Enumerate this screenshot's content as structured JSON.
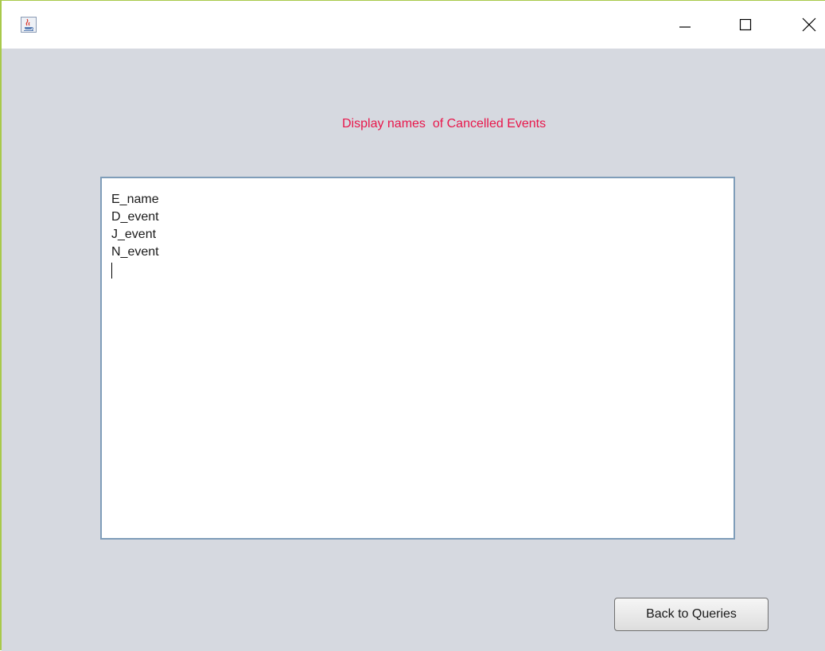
{
  "window": {
    "app_icon": "java-coffee-cup-icon",
    "controls": {
      "minimize_icon": "minimize-icon",
      "maximize_icon": "maximize-icon",
      "close_icon": "close-icon"
    }
  },
  "main": {
    "heading": "Display names  of Cancelled Events",
    "heading_color": "#e8174b",
    "results": {
      "lines": [
        "E_name",
        "D_event",
        "J_event",
        "N_event"
      ]
    },
    "back_button_label": "Back to Queries"
  }
}
